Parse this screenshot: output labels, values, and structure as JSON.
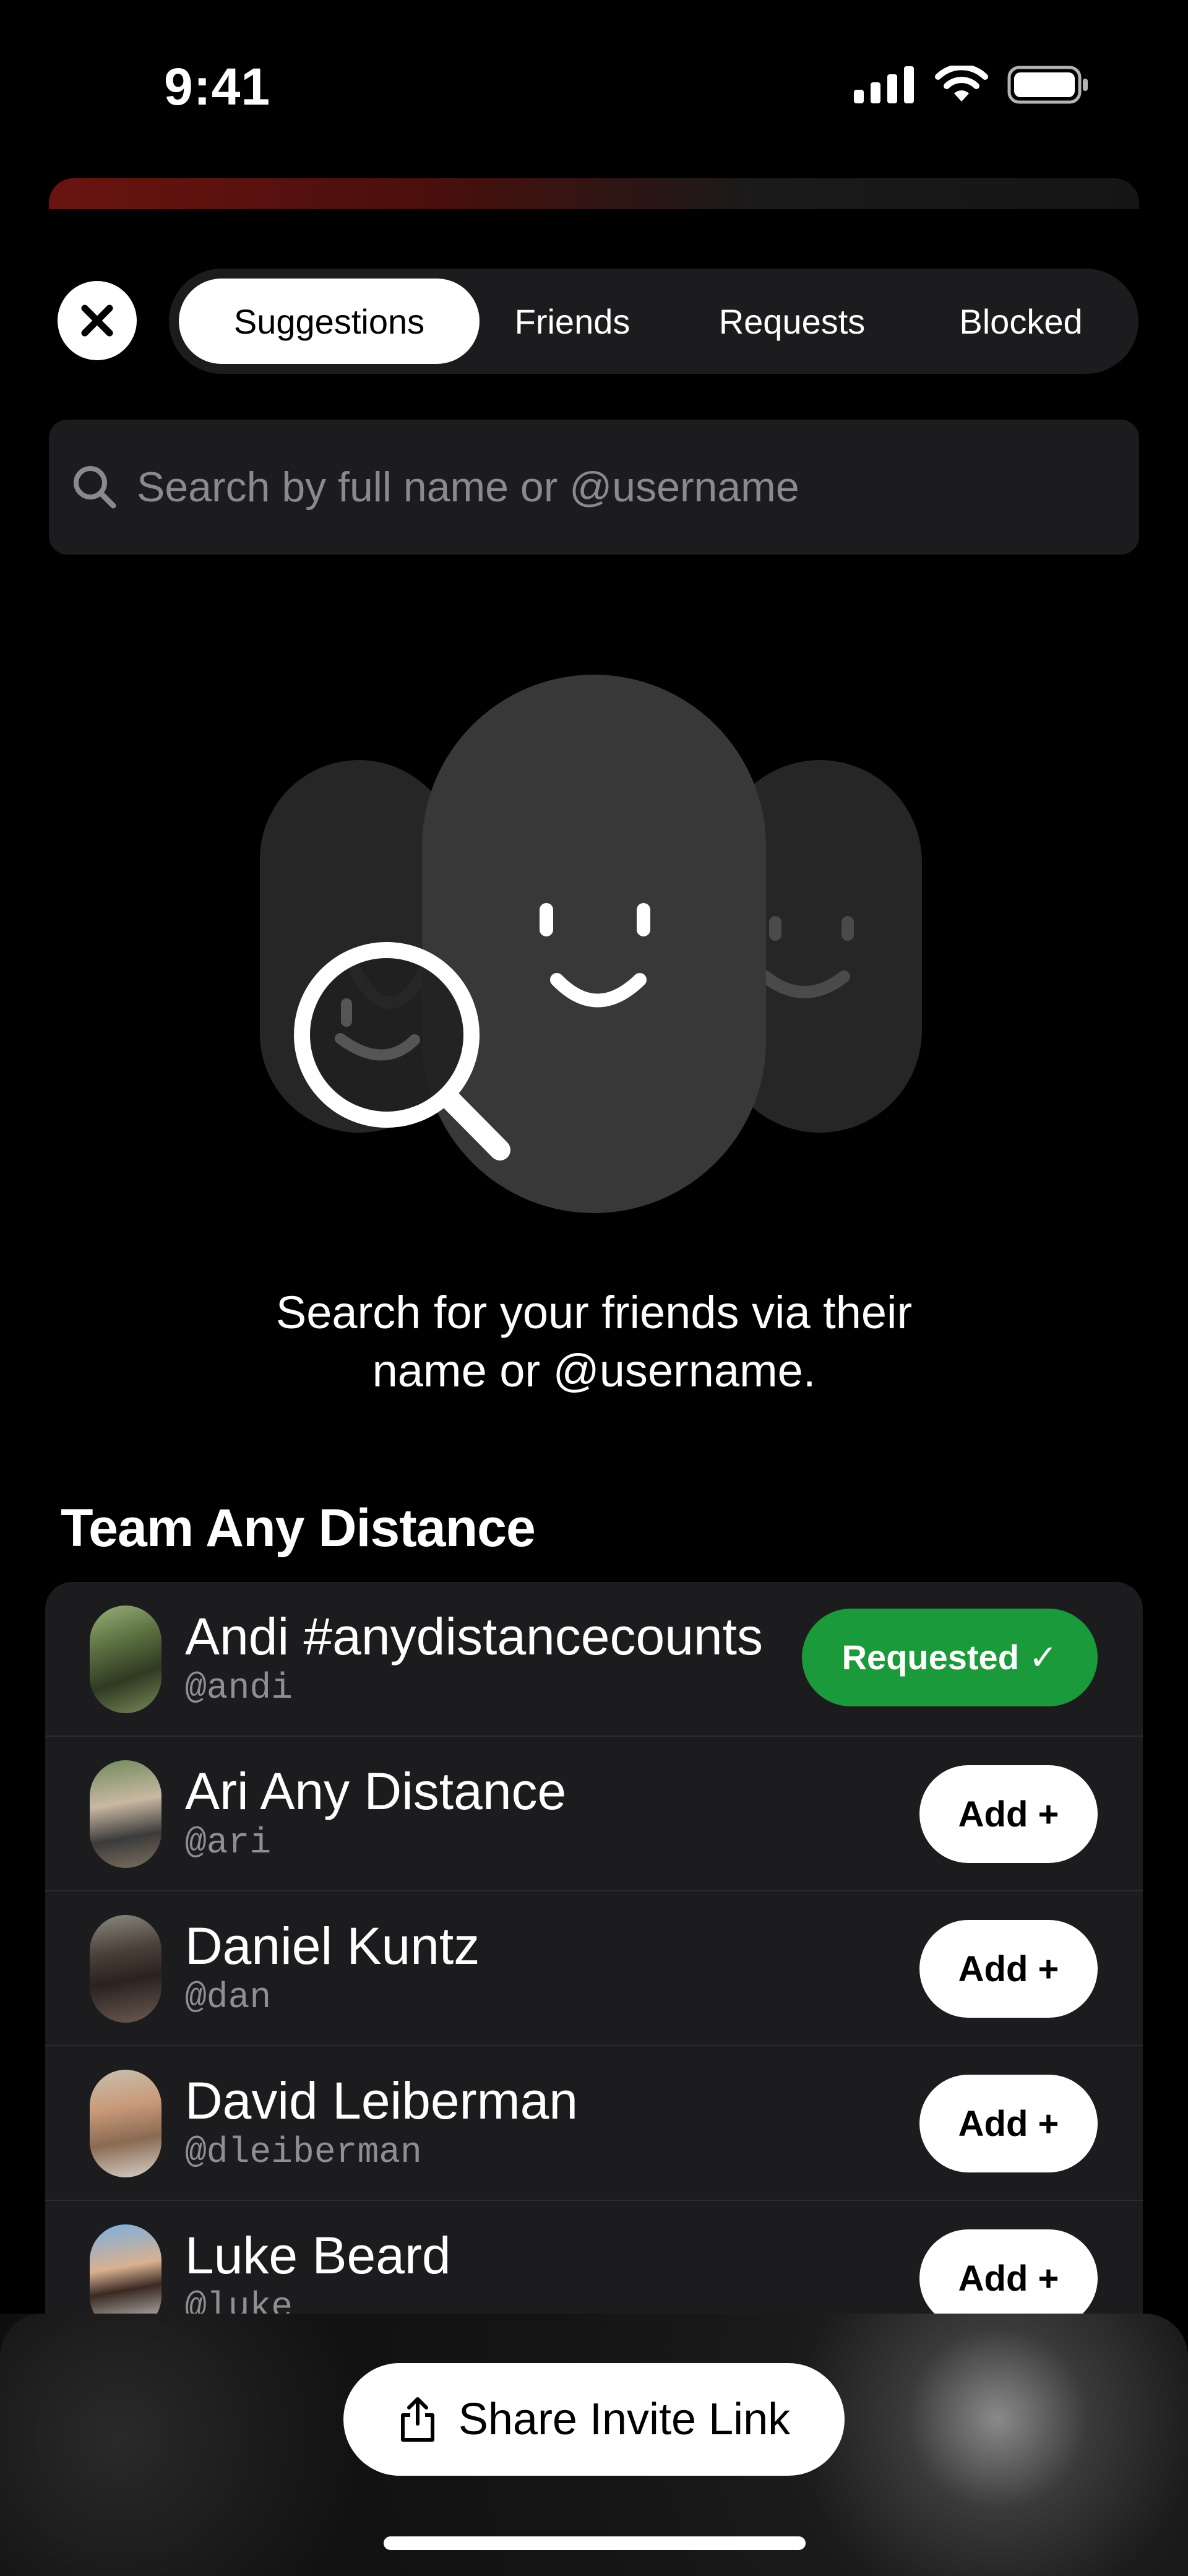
{
  "status_bar": {
    "time": "9:41"
  },
  "tabs": [
    {
      "label": "Suggestions",
      "active": true
    },
    {
      "label": "Friends",
      "active": false
    },
    {
      "label": "Requests",
      "active": false
    },
    {
      "label": "Blocked",
      "active": false
    }
  ],
  "search": {
    "placeholder": "Search by full name or @username",
    "value": ""
  },
  "empty_state": {
    "line1": "Search for your friends via their",
    "line2": "name or @username."
  },
  "section": {
    "title": "Team Any Distance"
  },
  "people": [
    {
      "name": "Andi #anydistancecounts",
      "handle": "@andi",
      "action": "Requested ✓",
      "status": "requested"
    },
    {
      "name": "Ari Any Distance",
      "handle": "@ari",
      "action": "Add +",
      "status": "add"
    },
    {
      "name": "Daniel Kuntz",
      "handle": "@dan",
      "action": "Add +",
      "status": "add"
    },
    {
      "name": "David Leiberman",
      "handle": "@dleiberman",
      "action": "Add +",
      "status": "add"
    },
    {
      "name": "Luke Beard",
      "handle": "@luke",
      "action": "Add +",
      "status": "add"
    }
  ],
  "share": {
    "label": "Share Invite Link"
  },
  "colors": {
    "accent_green": "#1a9a3a",
    "background": "#000000",
    "card": "#1c1c1e"
  }
}
